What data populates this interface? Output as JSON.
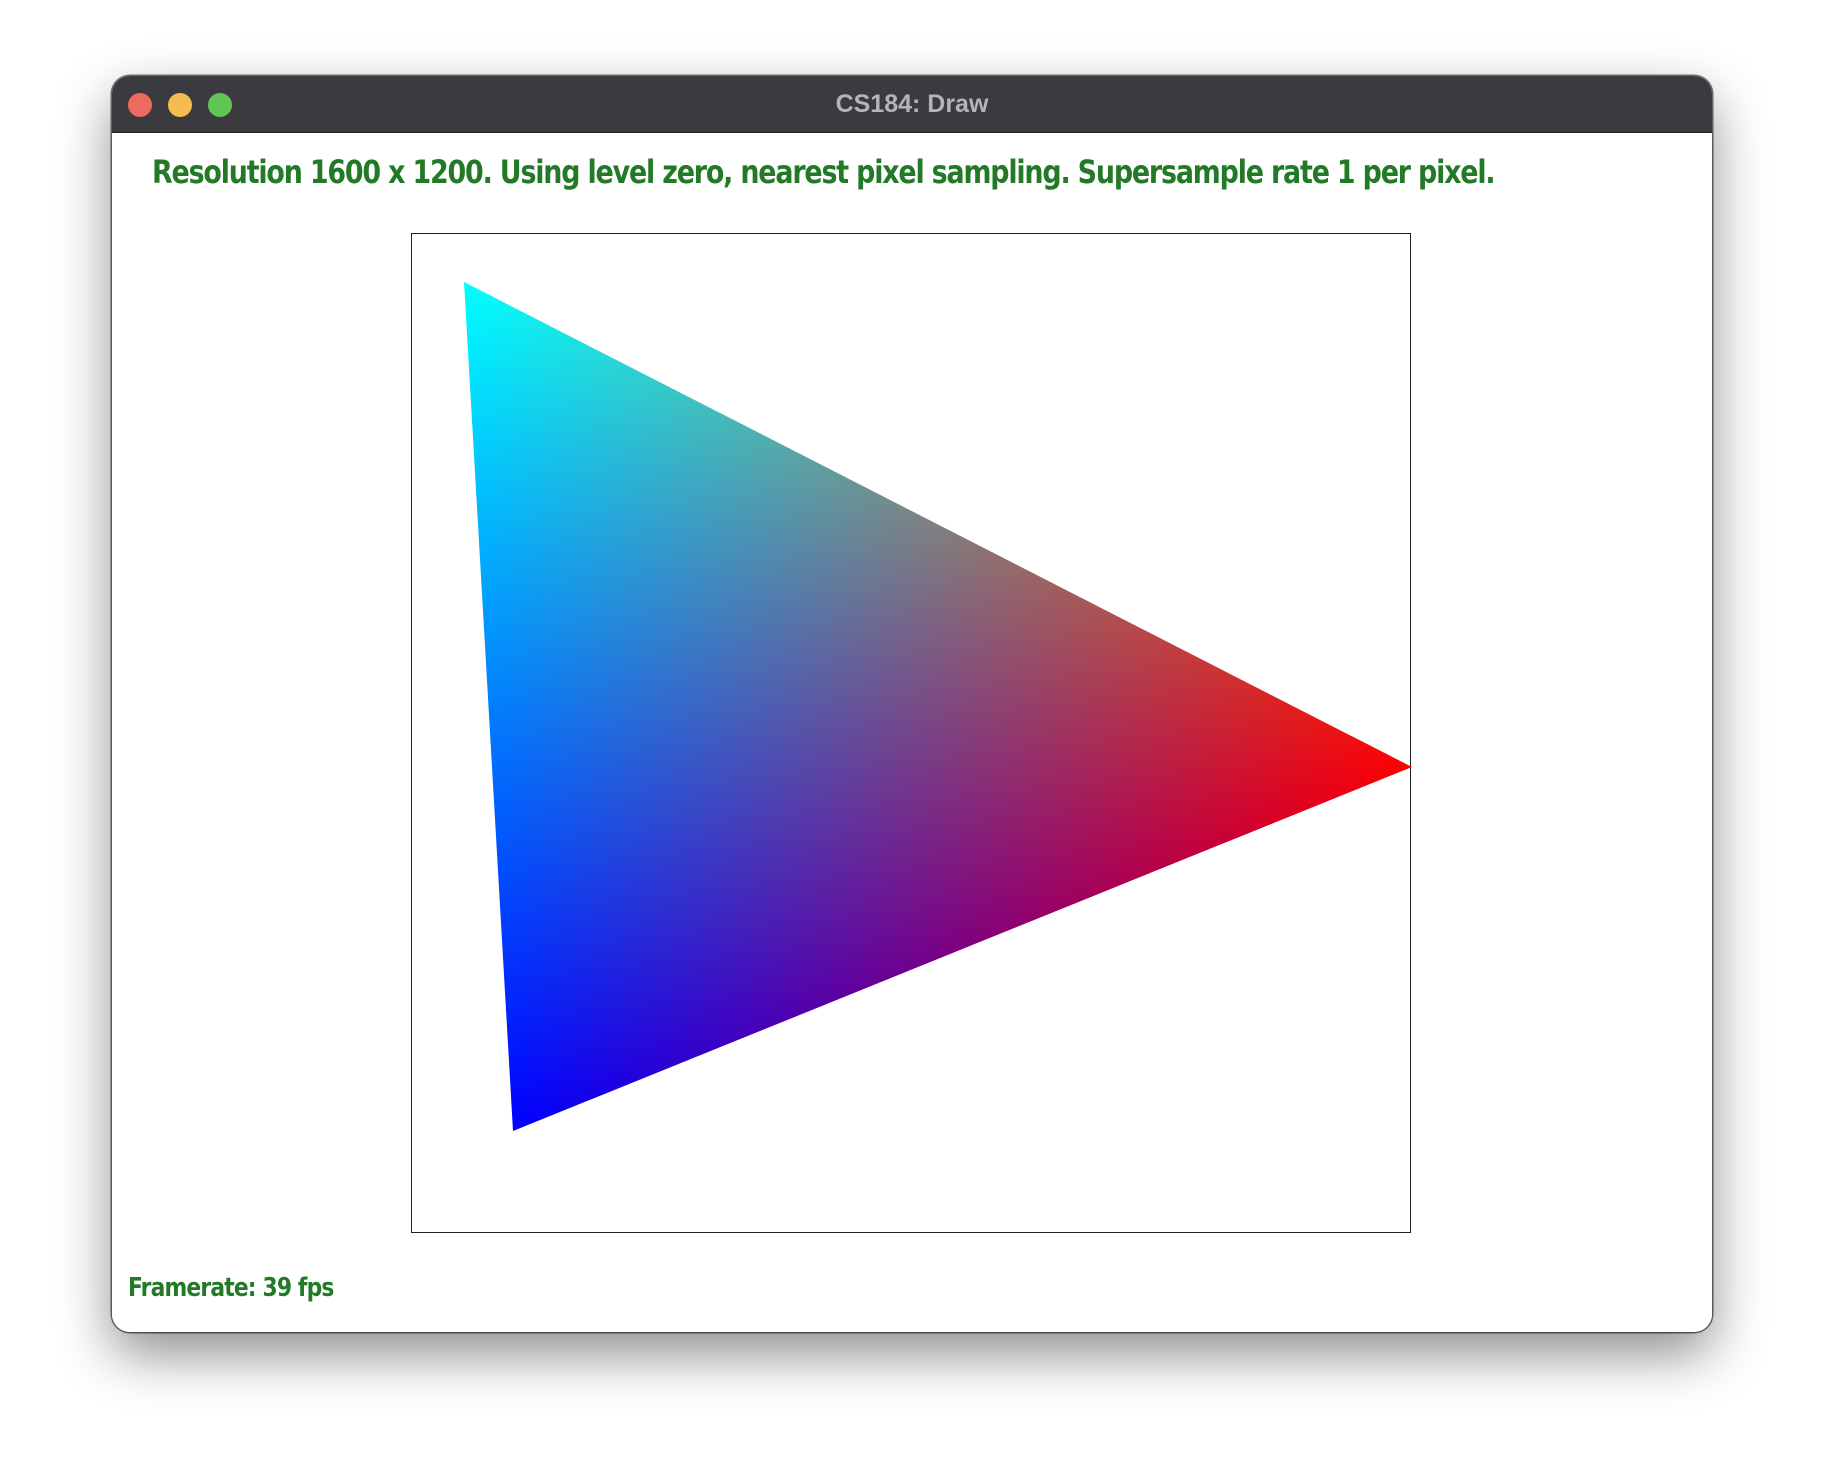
{
  "window": {
    "title": "CS184: Draw"
  },
  "status": {
    "text": "Resolution 1600 x 1200. Using level zero, nearest pixel sampling. Supersample rate 1 per pixel."
  },
  "footer": {
    "framerate": "Framerate: 39 fps"
  },
  "triangle": {
    "vertex_colors": [
      "#00ffff",
      "#ff0000",
      "#0000ff"
    ]
  },
  "colors": {
    "status_text": "#237a26",
    "titlebar": "#3a3a3f"
  }
}
